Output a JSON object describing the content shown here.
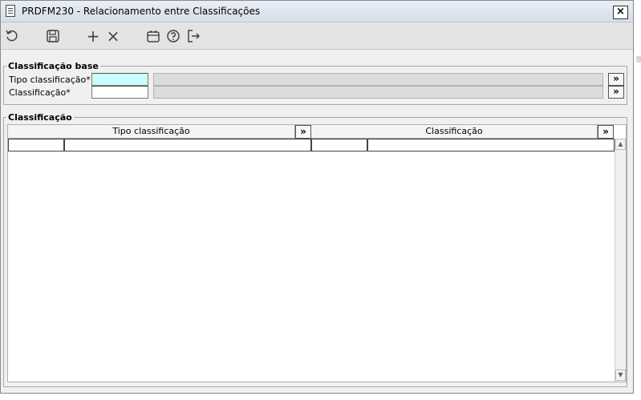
{
  "window": {
    "title": "PRDFM230 - Relacionamento entre Classificações",
    "close_label": "×"
  },
  "toolbar": {
    "buttons": [
      {
        "name": "undo-icon"
      },
      {
        "name": "save-icon"
      },
      {
        "name": "add-icon"
      },
      {
        "name": "delete-icon"
      },
      {
        "name": "calendar-icon"
      },
      {
        "name": "help-icon"
      },
      {
        "name": "exit-icon"
      }
    ],
    "add_glyph": "+",
    "delete_glyph": "×"
  },
  "base_group": {
    "legend": "Classificação base",
    "tipo_label": "Tipo classificação*",
    "tipo_value": "",
    "tipo_desc": "",
    "classif_label": "Classificação*",
    "classif_value": "",
    "classif_desc": "",
    "lookup_label": "»"
  },
  "grid_group": {
    "legend": "Classificação",
    "columns": [
      {
        "header": "Tipo classificação",
        "button": "»"
      },
      {
        "header": "Classificação",
        "button": "»"
      }
    ],
    "rows": [
      {
        "tipo_code": "",
        "tipo_desc": "",
        "classif_code": "",
        "classif_desc": ""
      }
    ],
    "scroll_up": "▲",
    "scroll_down": "▼"
  },
  "colors": {
    "focus_field": "#c8fcfe",
    "readonly_field": "#dcdcdc",
    "window_bg": "#f0f0f0"
  }
}
